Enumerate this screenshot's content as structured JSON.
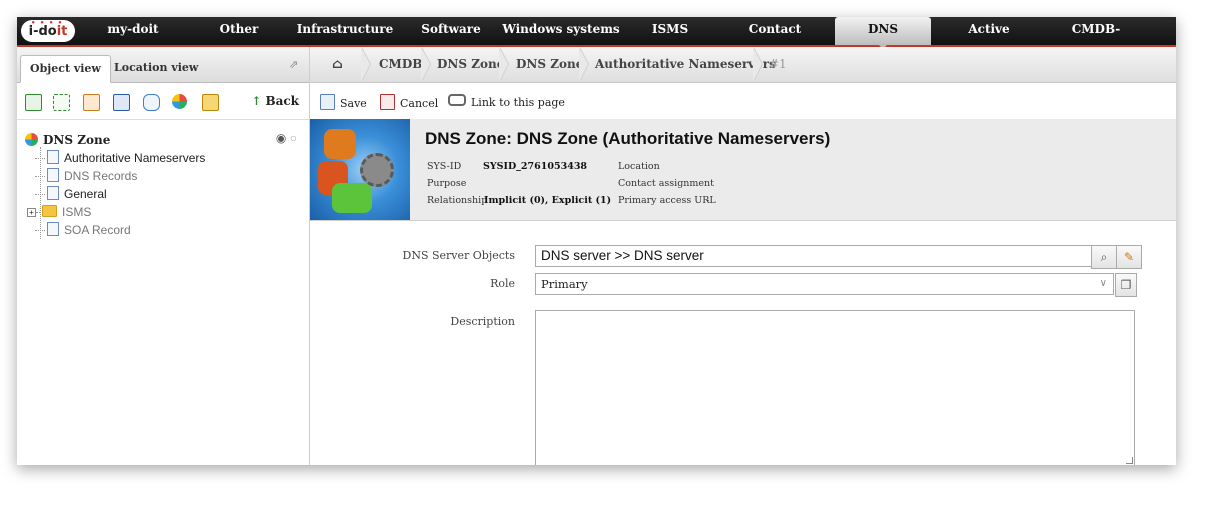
{
  "app": {
    "logo_text": "i-doit"
  },
  "topnav": {
    "items": [
      {
        "label": "my-doit"
      },
      {
        "label": "Other"
      },
      {
        "label": "Infrastructure"
      },
      {
        "label": "Software"
      },
      {
        "label": "Windows systems"
      },
      {
        "label": "ISMS"
      },
      {
        "label": "Contact"
      },
      {
        "label": "DNS",
        "active": true
      },
      {
        "label": "Active directory"
      },
      {
        "label": "CMDB-Explorer"
      }
    ]
  },
  "leftpanel": {
    "tabs": [
      {
        "label": "Object view",
        "active": true
      },
      {
        "label": "Location view"
      }
    ],
    "back_label": "Back",
    "tree": {
      "root": "DNS Zone",
      "items": [
        {
          "label": "Authoritative Nameservers",
          "dim": false
        },
        {
          "label": "DNS Records",
          "dim": true
        },
        {
          "label": "General",
          "dim": false
        },
        {
          "label": "ISMS",
          "dim": true,
          "folder": true
        },
        {
          "label": "SOA Record",
          "dim": true
        }
      ]
    }
  },
  "breadcrumb": {
    "items": [
      "CMDB",
      "DNS Zone",
      "DNS Zone",
      "Authoritative Nameservers",
      "#1"
    ]
  },
  "actions": {
    "save": "Save",
    "cancel": "Cancel",
    "link": "Link to this page"
  },
  "header": {
    "title": "DNS Zone: DNS Zone (Authoritative Nameservers)",
    "sysid_label": "SYS-ID",
    "sysid_value": "SYSID_2761053438",
    "purpose_label": "Purpose",
    "relationship_label": "Relationship",
    "relationship_value": "Implicit (0), Explicit (1)",
    "location_label": "Location",
    "contact_label": "Contact assignment",
    "primary_url_label": "Primary access URL",
    "primary_url_value": "-"
  },
  "form": {
    "dns_server_label": "DNS Server Objects",
    "dns_server_value": "DNS server >> DNS server",
    "role_label": "Role",
    "role_value": "Primary",
    "description_label": "Description"
  },
  "colors": {
    "nav_bg": "#111111",
    "accent": "#c0392b"
  }
}
